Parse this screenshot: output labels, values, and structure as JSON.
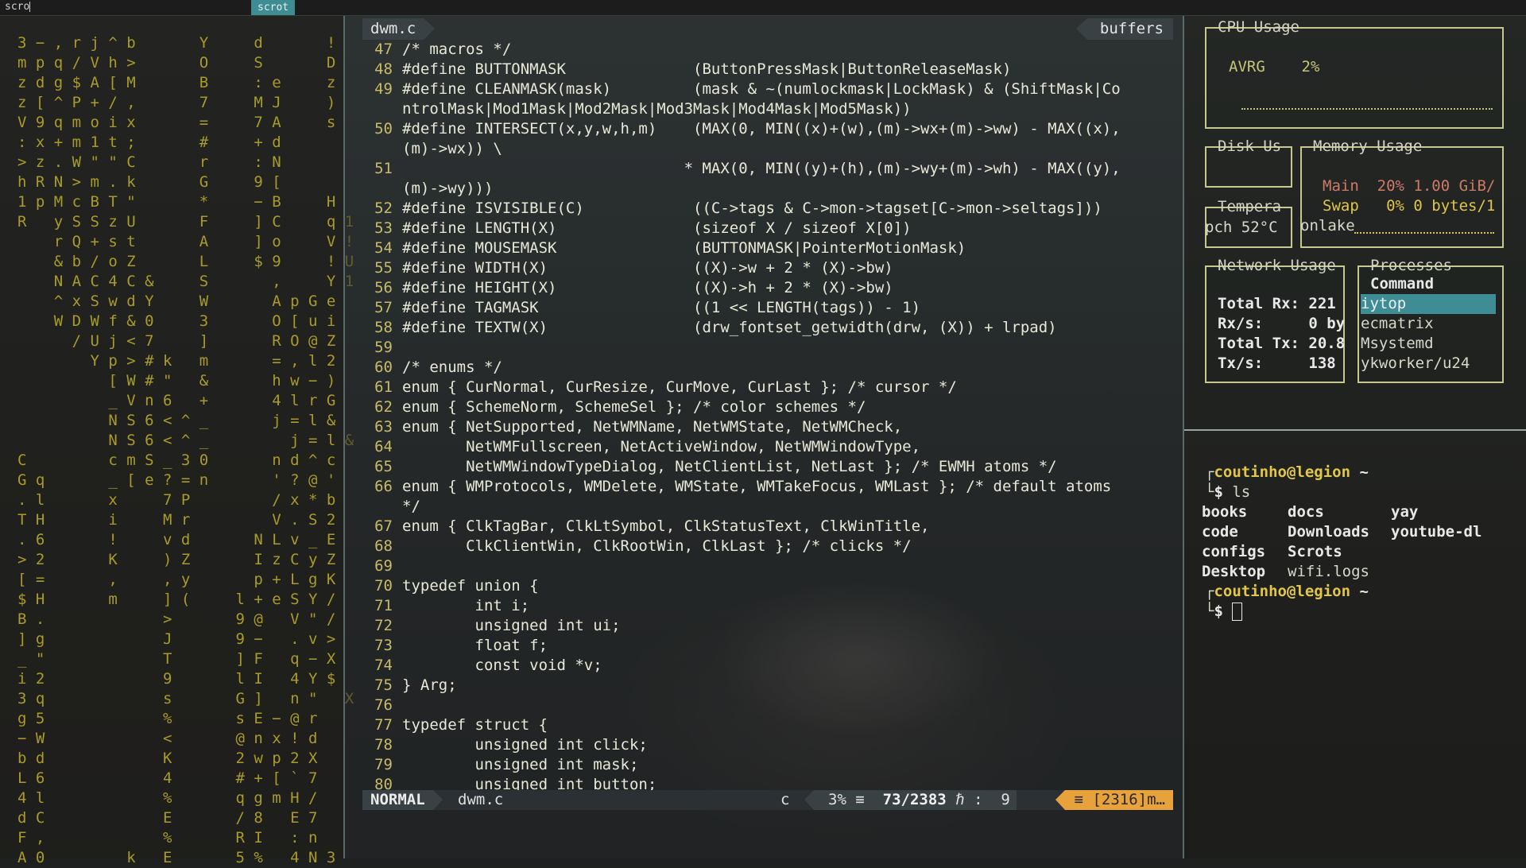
{
  "dmenu": {
    "input": "scro",
    "selected": "scrot"
  },
  "matrix": {
    "text": "3 − , r j ^ b       Y     d       !\nm p q / V h >       O     S       D\nz d g $ A [ M       B     : e     z\nz [ ^ P + / ,       7     M J     )\nV 9 q m o i x       =     7 A     s\n: x + m 1 t ;       #     + d\n> z . W \" \" C       r     : N\nh R N > m . k       G     9 [\n1 p M c B T \"       *     − B     H\nR   y S S z U       F     ] C     q 1\n    r Q + s t       A     ] o     V !\n    & b / o Z       L     $ 9     ! U\n    N A C 4 C &     S       ,     Y 1\n    ^ x S w d Y     W       A p G e\n    W D W f & 0     3       O [ u i\n      / U j < 7     ]       R O @ Z\n        Y p > # k   m       = , l 2\n          [ W # \"   &       h w − )\n          _ V n 6   +       4 l r G\n          N S 6 < ^ _       j = l &\n          N S 6 < ^ _         j = l &\nC         c m S _ 3 0       n d ^ c\nG q       _ [ e ? = n       ' ? @ '\n. l       x     7 P         / x * b\nT H       i     M r         V . S 2\n. 6       !     v d       N L v _ E\n> 2       K     ) Z       I z C y Z\n[ =       ,     , y       p + L g K\n$ H       m     ] (     l + e S Y /\nB .             >       9 @   V \" /\n] g             J       9 −   . v >\n_ \"             T       ] F   q − X\ni 2             9       l I   4 Y $\n3 q             s       G ]   n \"   X\ng 5             %       s E − @ r\n− W             <       @ n x ! d\nb d             K       2 w p 2 X\nL 6             4       # + [ ` 7\n4 l             %       q g m H /\nd C             E       / 8   E 7\nF ,             %       R I   : n\nA 0         k   E       5 %   4 N 3"
  },
  "editor": {
    "tab_name": "dwm.c",
    "buffers_label": "buffers",
    "lines": [
      {
        "n": "47",
        "t": "/* macros */"
      },
      {
        "n": "48",
        "t": "#define BUTTONMASK              (ButtonPressMask|ButtonReleaseMask)"
      },
      {
        "n": "49",
        "t": "#define CLEANMASK(mask)         (mask & ~(numlockmask|LockMask) & (ShiftMask|Co"
      },
      {
        "n": "",
        "t": "ntrolMask|Mod1Mask|Mod2Mask|Mod3Mask|Mod4Mask|Mod5Mask))"
      },
      {
        "n": "50",
        "t": "#define INTERSECT(x,y,w,h,m)    (MAX(0, MIN((x)+(w),(m)->wx+(m)->ww) - MAX((x),"
      },
      {
        "n": "",
        "t": "(m)->wx)) \\"
      },
      {
        "n": "51",
        "t": "                               * MAX(0, MIN((y)+(h),(m)->wy+(m)->wh) - MAX((y),"
      },
      {
        "n": "",
        "t": "(m)->wy)))"
      },
      {
        "n": "52",
        "t": "#define ISVISIBLE(C)            ((C->tags & C->mon->tagset[C->mon->seltags]))"
      },
      {
        "n": "53",
        "t": "#define LENGTH(X)               (sizeof X / sizeof X[0])"
      },
      {
        "n": "54",
        "t": "#define MOUSEMASK               (BUTTONMASK|PointerMotionMask)"
      },
      {
        "n": "55",
        "t": "#define WIDTH(X)                ((X)->w + 2 * (X)->bw)"
      },
      {
        "n": "56",
        "t": "#define HEIGHT(X)               ((X)->h + 2 * (X)->bw)"
      },
      {
        "n": "57",
        "t": "#define TAGMASK                 ((1 << LENGTH(tags)) - 1)"
      },
      {
        "n": "58",
        "t": "#define TEXTW(X)                (drw_fontset_getwidth(drw, (X)) + lrpad)"
      },
      {
        "n": "59",
        "t": ""
      },
      {
        "n": "60",
        "t": "/* enums */"
      },
      {
        "n": "61",
        "t": "enum { CurNormal, CurResize, CurMove, CurLast }; /* cursor */"
      },
      {
        "n": "62",
        "t": "enum { SchemeNorm, SchemeSel }; /* color schemes */"
      },
      {
        "n": "63",
        "t": "enum { NetSupported, NetWMName, NetWMState, NetWMCheck,"
      },
      {
        "n": "64",
        "t": "       NetWMFullscreen, NetActiveWindow, NetWMWindowType,"
      },
      {
        "n": "65",
        "t": "       NetWMWindowTypeDialog, NetClientList, NetLast }; /* EWMH atoms */"
      },
      {
        "n": "66",
        "t": "enum { WMProtocols, WMDelete, WMState, WMTakeFocus, WMLast }; /* default atoms"
      },
      {
        "n": "",
        "t": "*/"
      },
      {
        "n": "67",
        "t": "enum { ClkTagBar, ClkLtSymbol, ClkStatusText, ClkWinTitle,"
      },
      {
        "n": "68",
        "t": "       ClkClientWin, ClkRootWin, ClkLast }; /* clicks */"
      },
      {
        "n": "69",
        "t": ""
      },
      {
        "n": "70",
        "t": "typedef union {"
      },
      {
        "n": "71",
        "t": "        int i;"
      },
      {
        "n": "72",
        "t": "        unsigned int ui;"
      },
      {
        "n": "73",
        "t": "        float f;"
      },
      {
        "n": "74",
        "t": "        const void *v;"
      },
      {
        "n": "75",
        "t": "} Arg;"
      },
      {
        "n": "76",
        "t": ""
      },
      {
        "n": "77",
        "t": "typedef struct {"
      },
      {
        "n": "78",
        "t": "        unsigned int click;"
      },
      {
        "n": "79",
        "t": "        unsigned int mask;"
      },
      {
        "n": "80",
        "t": "        unsigned int button;"
      }
    ],
    "status": {
      "mode": "NORMAL",
      "file": "dwm.c",
      "filetype": "c",
      "percent": "3% ≡",
      "position": "73/2383",
      "col_icon": "ℏ :",
      "col": "9",
      "warning": "≡ [2316]m…"
    }
  },
  "ytop": {
    "cpu_title": "CPU Usage",
    "cpu_label": "AVRG",
    "cpu_value": "2%",
    "disk_title": "Disk Us",
    "temp_title": "Tempera",
    "temp_row": "pch 52°C",
    "memory_title": "Memory Usage",
    "mem_main": "Main  20% 1.00 GiB/",
    "mem_swap": "Swap   0% 0 bytes/1",
    "mem_extra": "onlake",
    "network_title": "Network Usage",
    "net_total_rx": "Total Rx: 221",
    "net_rxs": "Rx/s:     0 by",
    "net_total_tx": "Total Tx: 20.8",
    "net_txs": "Tx/s:     138",
    "processes_title": "Processes",
    "proc_header": "Command",
    "processes": [
      "iytop",
      "ecmatrix",
      "Msystemd",
      "ykworker/u24"
    ],
    "accent_color": "#3e8c94"
  },
  "terminal": {
    "prompt_user": "coutinho@legion",
    "prompt_dir": "~",
    "command": "ls",
    "ls_col1": [
      "books",
      "code",
      "configs",
      "Desktop"
    ],
    "ls_col2": [
      "docs",
      "Downloads",
      "Scrots",
      "wifi.logs"
    ],
    "ls_col3": [
      "yay",
      "youtube-dl"
    ],
    "prompt_symbol": "$"
  }
}
